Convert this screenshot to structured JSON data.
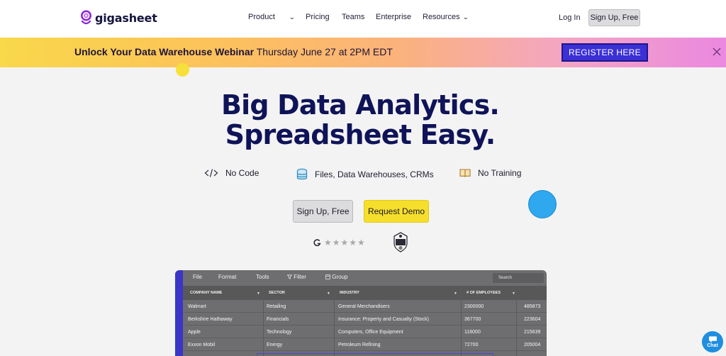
{
  "nav": {
    "logo_text": "gigasheet",
    "items": [
      {
        "label": "Product",
        "has_chevron": true
      },
      {
        "label": "Pricing"
      },
      {
        "label": "Teams"
      },
      {
        "label": "Enterprise"
      },
      {
        "label": "Resources",
        "has_chevron": true
      }
    ],
    "login_label": "Log In",
    "signup_label": "Sign Up, Free"
  },
  "banner": {
    "strong_text": "Unlock Your Data Warehouse Webinar",
    "rest_text": " Thursday June 27 at 2PM EDT",
    "register_label": "REGISTER HERE",
    "close_icon": "close-icon"
  },
  "hero": {
    "line1": "Big Data Analytics.",
    "line2": "Spreadsheet Easy.",
    "features": [
      {
        "icon": "code-icon",
        "label": "No Code"
      },
      {
        "icon": "database-icon",
        "label": "Files, Data Warehouses, CRMs"
      },
      {
        "icon": "book-icon",
        "label": "No Training"
      }
    ],
    "signup_label": "Sign Up, Free",
    "demo_label": "Request Demo",
    "rating_stars": 5,
    "soc_badge_icon": "soc2-badge-icon"
  },
  "app_preview": {
    "menu": [
      "File",
      "Format",
      "Tools",
      "Filter",
      "Group"
    ],
    "search_placeholder": "Search",
    "columns": [
      "COMPANY NAME",
      "SECTOR",
      "INDUSTRY",
      "# OF EMPLOYEES"
    ],
    "rows": [
      [
        "Walmart",
        "Retailing",
        "General Merchandisers",
        "2300000",
        "485873"
      ],
      [
        "Berkshire Hathaway",
        "Financials",
        "Insurance: Property and Casualty (Stock)",
        "367700",
        "223604"
      ],
      [
        "Apple",
        "Technology",
        "Computers, Office Equipment",
        "116000",
        "215639"
      ],
      [
        "Exxon Mobil",
        "Energy",
        "Petroleum Refining",
        "72700",
        "205004"
      ]
    ]
  },
  "chat": {
    "label": "Chat"
  },
  "colors": {
    "headline": "#0f1458",
    "register_bg": "#3b2fd6",
    "demo_bg": "#f6df2c",
    "accent_dot_blue": "#2fa8f0",
    "accent_dot_yellow": "#f7e03b"
  }
}
